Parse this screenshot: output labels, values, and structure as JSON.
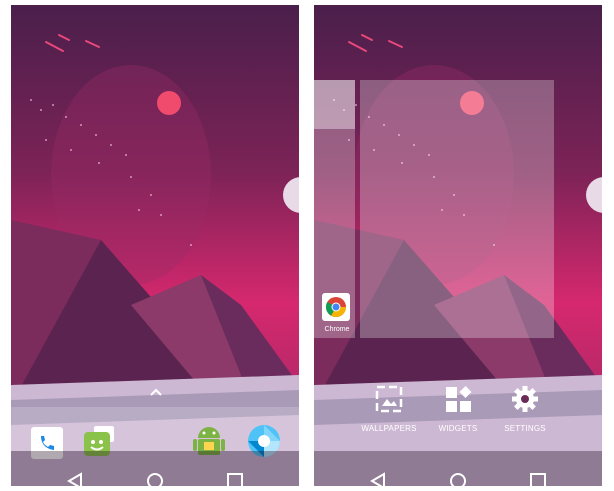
{
  "left_screen": {
    "dock_apps": [
      {
        "icon": "phone-icon"
      },
      {
        "icon": "messenger-icon"
      },
      {
        "icon": "android-app-icon"
      },
      {
        "icon": "camera-lens-icon"
      }
    ],
    "app_drawer_icon": "chevron-up-icon"
  },
  "right_screen": {
    "chrome_shortcut": {
      "label": "Chrome",
      "icon": "chrome-icon"
    },
    "options": [
      {
        "label": "WALLPAPERS",
        "icon": "wallpapers-icon"
      },
      {
        "label": "WIDGETS",
        "icon": "widgets-icon"
      },
      {
        "label": "SETTINGS",
        "icon": "settings-icon"
      }
    ]
  },
  "nav_icons": [
    "back-icon",
    "home-icon",
    "recents-icon"
  ],
  "colors": {
    "wallpaper_top": "#4a1f4b",
    "wallpaper_mid": "#d6286e",
    "planet": "#f04b6c",
    "ground": "#cdb8d4"
  }
}
